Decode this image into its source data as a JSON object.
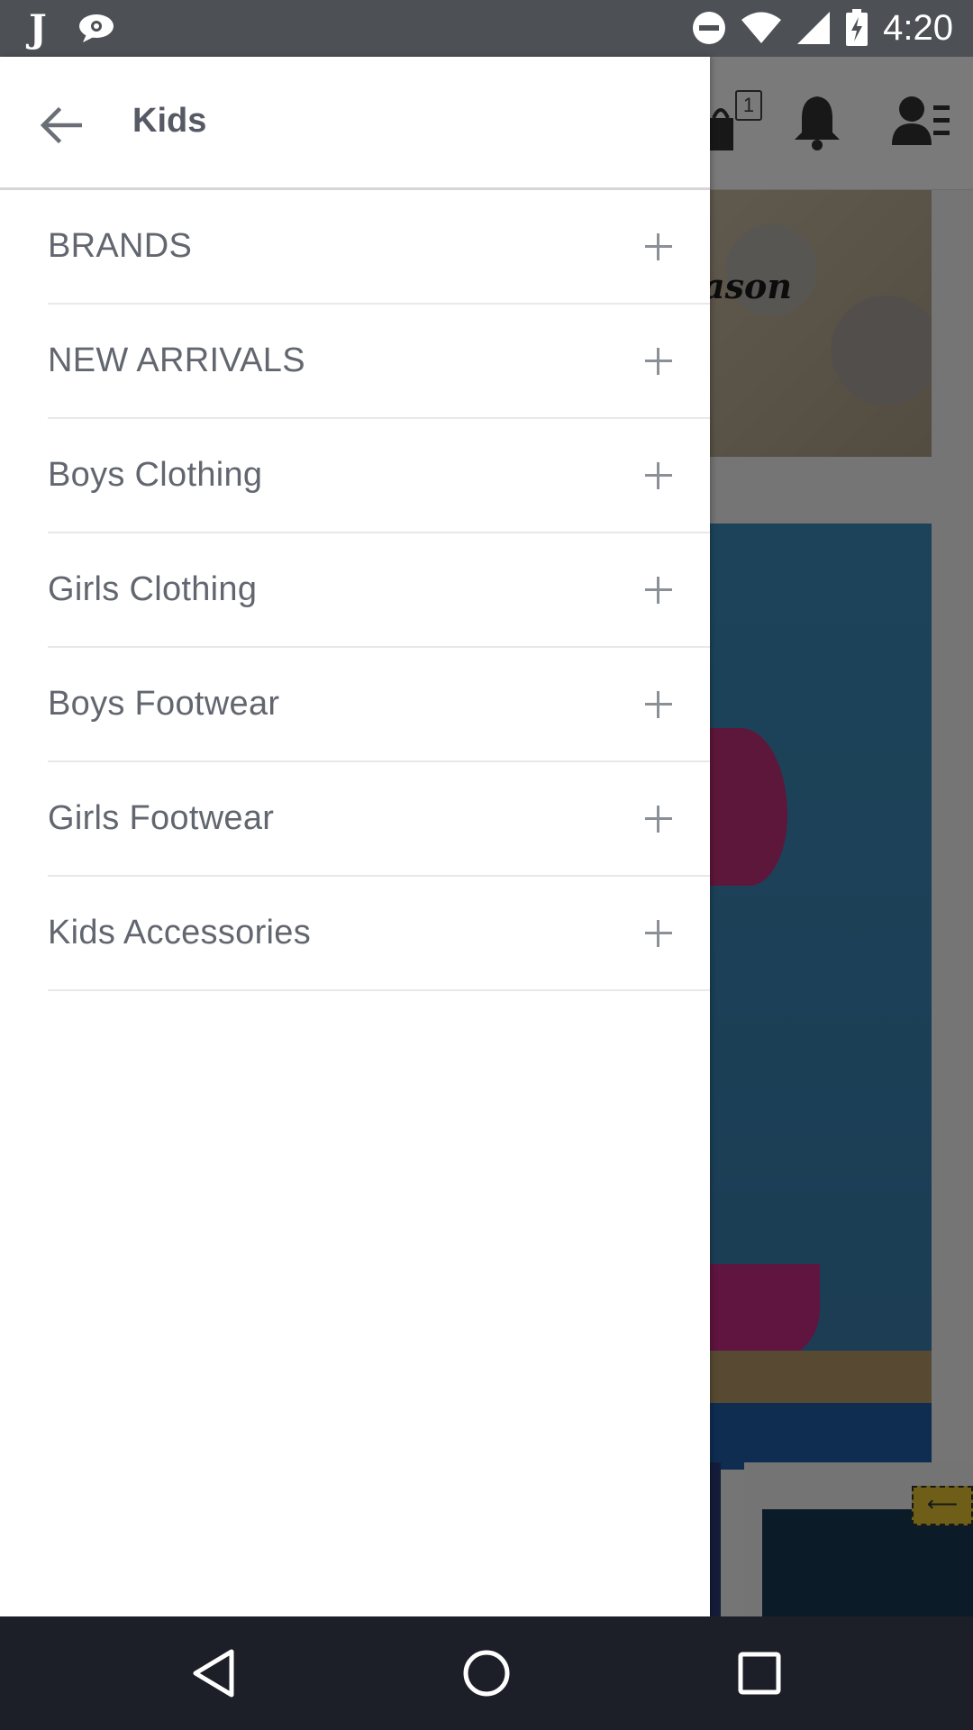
{
  "status_bar": {
    "time": "4:20",
    "left_icons": [
      "j-app-icon",
      "chat-bubble-icon"
    ],
    "right_icons": [
      "do-not-disturb-icon",
      "wifi-icon",
      "cell-signal-icon",
      "battery-charging-icon"
    ]
  },
  "background_app": {
    "cart_count": "1",
    "banner_fragment": "ason",
    "icons": [
      "cart-icon",
      "bell-icon",
      "account-menu-icon"
    ]
  },
  "drawer": {
    "title": "Kids",
    "back_icon": "back-arrow-icon",
    "items": [
      {
        "label": "BRANDS",
        "icon": "plus-icon"
      },
      {
        "label": "NEW ARRIVALS",
        "icon": "plus-icon"
      },
      {
        "label": "Boys Clothing",
        "icon": "plus-icon"
      },
      {
        "label": "Girls Clothing",
        "icon": "plus-icon"
      },
      {
        "label": "Boys Footwear",
        "icon": "plus-icon"
      },
      {
        "label": "Girls Footwear",
        "icon": "plus-icon"
      },
      {
        "label": "Kids Accessories",
        "icon": "plus-icon"
      }
    ]
  },
  "nav_bar": {
    "buttons": [
      "back-triangle-icon",
      "home-circle-icon",
      "recents-square-icon"
    ]
  },
  "colors": {
    "status_bar": "#4d5054",
    "nav_bar": "#1c1f28",
    "menu_text": "#62666f",
    "title_text": "#555a64",
    "divider": "#e8e8ea"
  }
}
